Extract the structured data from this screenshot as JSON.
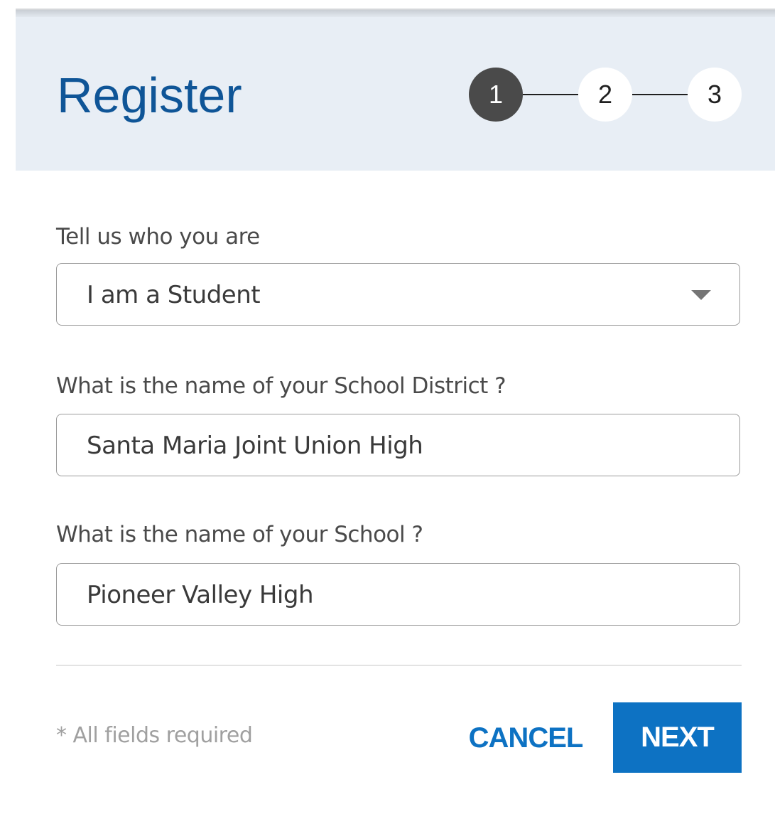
{
  "header": {
    "title": "Register",
    "steps": [
      {
        "label": "1",
        "state": "active"
      },
      {
        "label": "2",
        "state": "inactive"
      },
      {
        "label": "3",
        "state": "inactive"
      }
    ]
  },
  "form": {
    "role": {
      "label": "Tell us who you are",
      "value": "I am a Student",
      "icon": "caret-down-icon"
    },
    "district": {
      "label": "What is the name of your School District ?",
      "value": "Santa Maria Joint Union High"
    },
    "school": {
      "label": "What is the name of your School ?",
      "value": "Pioneer Valley High"
    }
  },
  "footer": {
    "required_note": "* All fields required",
    "cancel_label": "CANCEL",
    "next_label": "NEXT"
  },
  "colors": {
    "accent": "#0d72c3",
    "title": "#0f5597",
    "header_bg": "#e8eef5",
    "active_step": "#4a4a4a"
  }
}
